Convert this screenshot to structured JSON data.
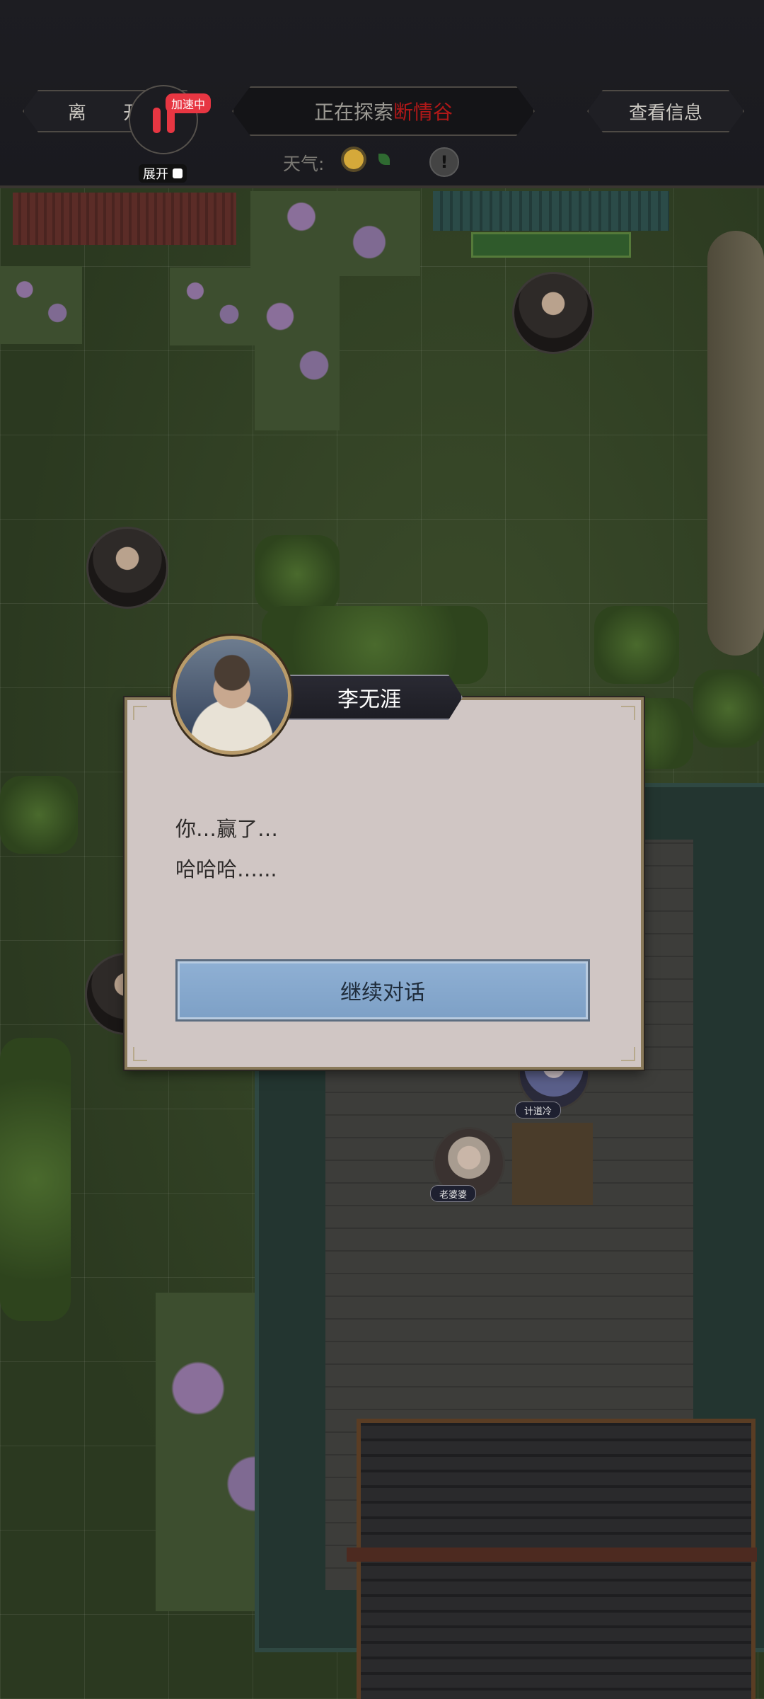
{
  "hud": {
    "leave_label": "离 开",
    "speed_badge": "加速中",
    "expand_label": "展开",
    "explore_prefix": "正在探索",
    "explore_place": "断情谷",
    "info_label": "查看信息",
    "weather_label": "天气:",
    "weather_icons": [
      "sun-icon",
      "leaf-icon"
    ],
    "colors": {
      "accent_red": "#e73642",
      "place_red": "#b01818"
    }
  },
  "map": {
    "npcs": [
      {
        "label": "计道冷"
      },
      {
        "label": "老婆婆"
      }
    ]
  },
  "dialog": {
    "speaker": "李无涯",
    "lines": [
      "你…赢了…",
      "哈哈哈…..."
    ],
    "continue_label": "继续对话",
    "colors": {
      "panel": "#d0c6c4",
      "button": "#8fb0d4"
    }
  }
}
